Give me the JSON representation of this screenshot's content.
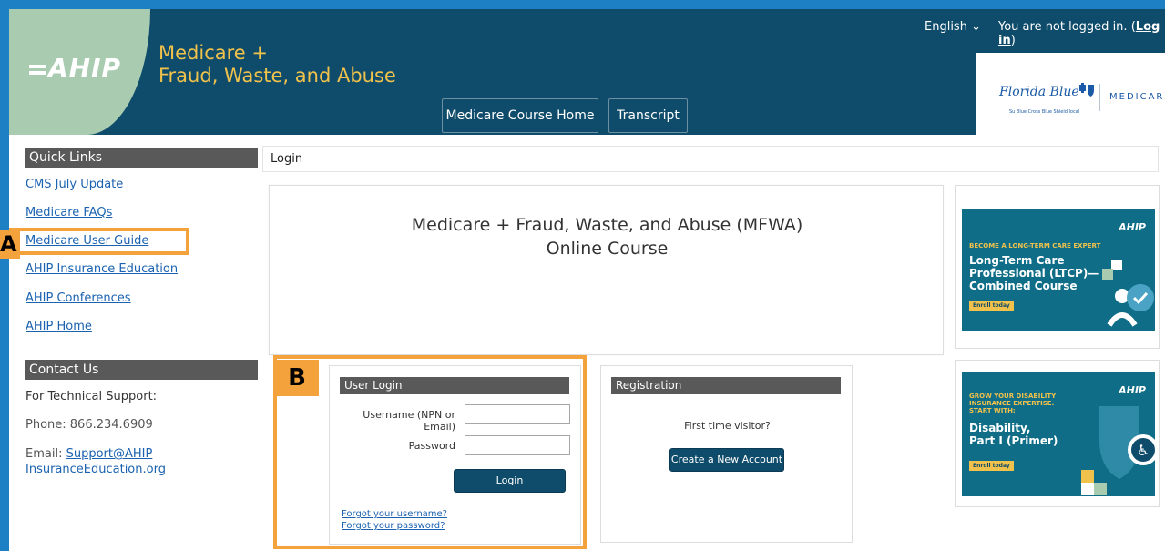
{
  "header": {
    "logo_text": "AHIP",
    "title_line1": "Medicare +",
    "title_line2": "Fraud, Waste, and Abuse",
    "language": "English",
    "login_status": "You are not logged in.",
    "login_link": "Log in",
    "nav": [
      {
        "label": "Medicare Course Home"
      },
      {
        "label": "Transcript"
      }
    ],
    "sponsor": {
      "name": "Florida Blue",
      "sub": "Su Blue Cross Blue Shield local",
      "tag": "MEDICARE"
    }
  },
  "sidebar": {
    "quick_links_heading": "Quick Links",
    "links": [
      {
        "label": "CMS July Update"
      },
      {
        "label": "Medicare FAQs"
      },
      {
        "label": "Medicare User Guide"
      },
      {
        "label": "AHIP Insurance Education"
      },
      {
        "label": "AHIP Conferences"
      },
      {
        "label": "AHIP Home"
      }
    ],
    "contact_heading": "Contact Us",
    "support_label": "For Technical Support:",
    "phone": "Phone: 866.234.6909",
    "email_label": "Email:",
    "email_line1": "Support@AHIP",
    "email_line2": "InsuranceEducation.org"
  },
  "annotations": {
    "a": "A",
    "b": "B"
  },
  "main": {
    "breadcrumb": "Login",
    "course_title_line1": "Medicare + Fraud, Waste, and Abuse (MFWA)",
    "course_title_line2": "Online Course",
    "login": {
      "heading": "User Login",
      "username_label": "Username (NPN or Email)",
      "password_label": "Password",
      "button": "Login",
      "forgot_username": "Forgot your username?",
      "forgot_password": "Forgot your password?"
    },
    "registration": {
      "heading": "Registration",
      "text": "First time visitor?",
      "button": "Create a New Account"
    }
  },
  "ads": [
    {
      "logo": "AHIP",
      "kicker": "BECOME A LONG-TERM CARE EXPERT",
      "headline_line1": "Long-Term Care",
      "headline_line2": "Professional (LTCP)—",
      "headline_line3": "Combined Course",
      "cta": "Enroll today"
    },
    {
      "logo": "AHIP",
      "kicker_line1": "GROW YOUR DISABILITY",
      "kicker_line2": "INSURANCE EXPERTISE.",
      "kicker_line3": "START WITH:",
      "headline_line1": "Disability,",
      "headline_line2": "Part I (Primer)",
      "cta": "Enroll today"
    }
  ],
  "colors": {
    "header_bg": "#0f4c6b",
    "accent_yellow": "#f0c24b",
    "annotation_orange": "#f3a23c",
    "link_blue": "#1b62b0"
  }
}
